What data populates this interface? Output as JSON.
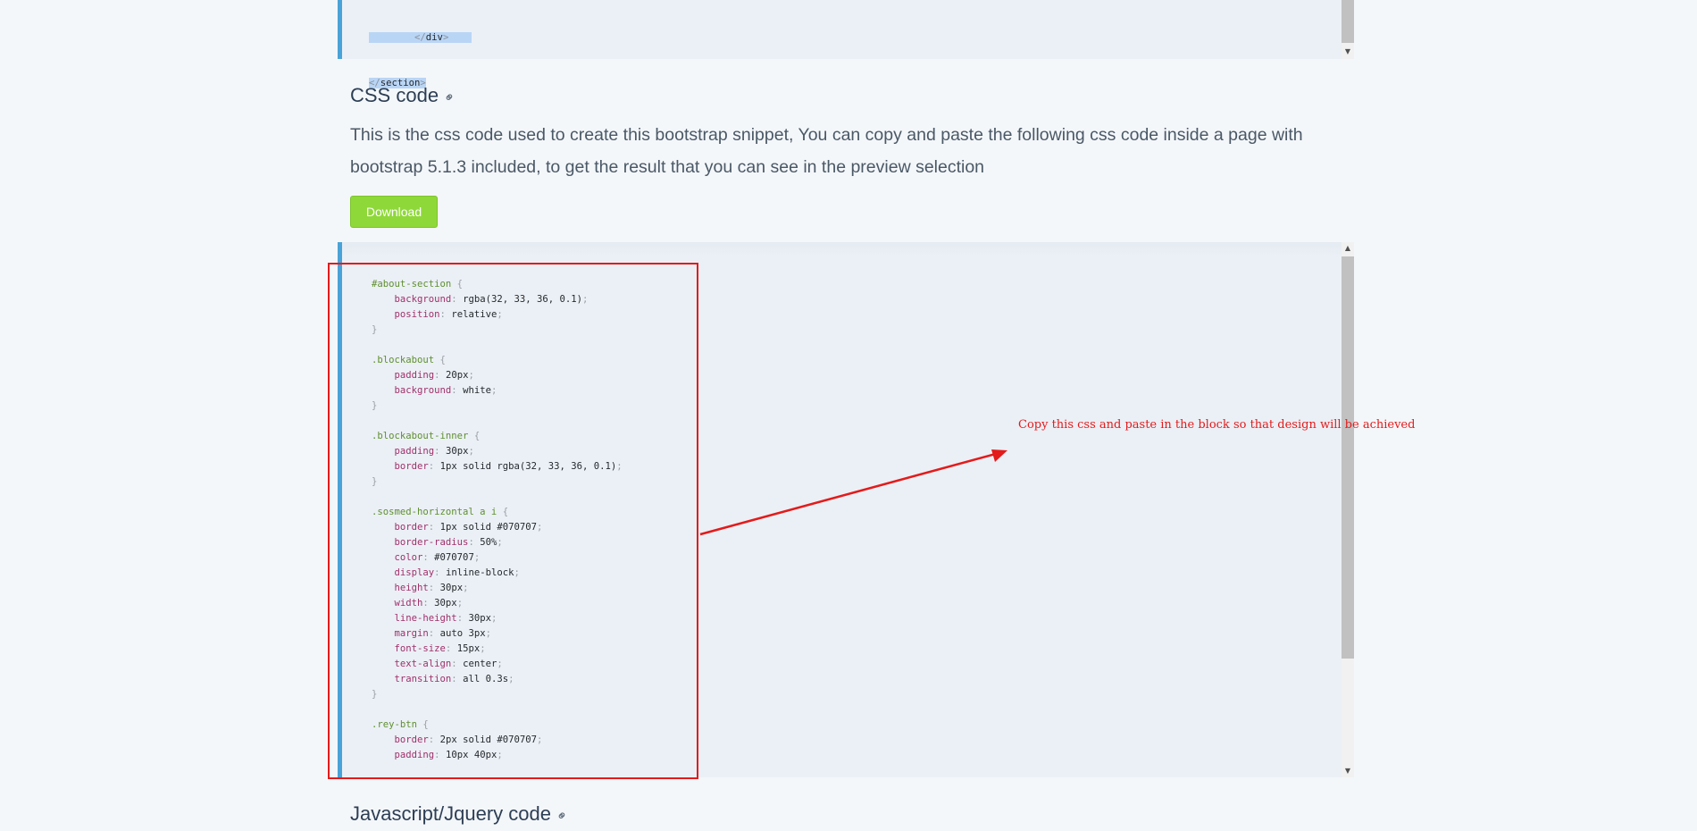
{
  "html_block": {
    "lines": [
      {
        "indent": "        ",
        "open": "</",
        "tag": "div",
        "close": ">"
      },
      {
        "indent": "",
        "open": "</",
        "tag": "section",
        "close": ">"
      }
    ]
  },
  "css_section": {
    "title": "CSS code",
    "link_icon": "link-icon",
    "description": "This is the css code used to create this bootstrap snippet, You can copy and paste the following css code inside a page with bootstrap 5.1.3 included, to get the result that you can see in the preview selection",
    "download_label": "Download"
  },
  "css_code": [
    {
      "t": "blank"
    },
    {
      "t": "sel",
      "s": "#about-section"
    },
    {
      "t": "decl",
      "p": "background",
      "v": "rgba(32, 33, 36, 0.1)"
    },
    {
      "t": "decl",
      "p": "position",
      "v": "relative"
    },
    {
      "t": "end"
    },
    {
      "t": "blank"
    },
    {
      "t": "sel",
      "s": ".blockabout"
    },
    {
      "t": "decl",
      "p": "padding",
      "v": "20px"
    },
    {
      "t": "decl",
      "p": "background",
      "v": "white"
    },
    {
      "t": "end"
    },
    {
      "t": "blank"
    },
    {
      "t": "sel",
      "s": ".blockabout-inner"
    },
    {
      "t": "decl",
      "p": "padding",
      "v": "30px"
    },
    {
      "t": "decl",
      "p": "border",
      "v": "1px solid rgba(32, 33, 36, 0.1)"
    },
    {
      "t": "end"
    },
    {
      "t": "blank"
    },
    {
      "t": "sel",
      "s": ".sosmed-horizontal a i"
    },
    {
      "t": "decl",
      "p": "border",
      "v": "1px solid #070707"
    },
    {
      "t": "decl",
      "p": "border-radius",
      "v": "50%"
    },
    {
      "t": "decl",
      "p": "color",
      "v": "#070707"
    },
    {
      "t": "decl",
      "p": "display",
      "v": "inline-block"
    },
    {
      "t": "decl",
      "p": "height",
      "v": "30px"
    },
    {
      "t": "decl",
      "p": "width",
      "v": "30px"
    },
    {
      "t": "decl",
      "p": "line-height",
      "v": "30px"
    },
    {
      "t": "decl",
      "p": "margin",
      "v": "auto 3px"
    },
    {
      "t": "decl",
      "p": "font-size",
      "v": "15px"
    },
    {
      "t": "decl",
      "p": "text-align",
      "v": "center"
    },
    {
      "t": "decl",
      "p": "transition",
      "v": "all 0.3s"
    },
    {
      "t": "end"
    },
    {
      "t": "blank"
    },
    {
      "t": "sel",
      "s": ".rey-btn"
    },
    {
      "t": "decl",
      "p": "border",
      "v": "2px solid #070707"
    },
    {
      "t": "decl",
      "p": "padding",
      "v": "10px 40px"
    }
  ],
  "annotation": "Copy this css and paste in the block so that design will be achieved",
  "js_section": {
    "title": "Javascript/Jquery code",
    "link_icon": "link-icon"
  },
  "colors": {
    "accent_border": "#4aa3d8",
    "button": "#8fd83a",
    "annotation_red": "#e31b1b"
  }
}
